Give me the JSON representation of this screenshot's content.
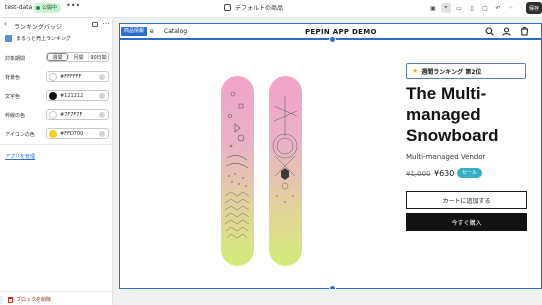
{
  "topbar": {
    "store_name": "test-data",
    "status_badge": "公開中",
    "more_label": "•••",
    "page_label": "デフォルトの商品",
    "save_label": "保存"
  },
  "panel": {
    "back_symbol": "‹",
    "title": "ランキングバッジ",
    "app_name": "まるっと売上ランキング",
    "period": {
      "label": "対象期間",
      "options": [
        "週間",
        "月間",
        "90日間"
      ],
      "selected": "週間"
    },
    "colors": [
      {
        "label": "背景色",
        "hex": "#FFFFFF",
        "swatch": "#FFFFFF"
      },
      {
        "label": "文字色",
        "hex": "#121212",
        "swatch": "#121212"
      },
      {
        "label": "枠線の色",
        "hex": "#7F7F7F",
        "swatch": "#FFFFFF"
      },
      {
        "label": "アイコンの色",
        "hex": "#FFD700",
        "swatch": "#F2D31B"
      }
    ],
    "manage_link": "アプリを管理",
    "remove_block": "ブロックを削除"
  },
  "preview": {
    "section_tag": "商品情報",
    "nav_home": "e",
    "nav_catalog": "Catalog",
    "brand": "PEPIN APP DEMO",
    "product": {
      "badge_text": "週間ランキング 第2位",
      "title": "The Multi-managed Snowboard",
      "vendor": "Multi-managed Vendor",
      "compare_price": "¥1,000",
      "price": "¥630",
      "sale_label": "セール",
      "add_to_cart": "カートに追加する",
      "buy_now": "今すぐ購入"
    }
  },
  "colors": {
    "accent": "#2C6ECB",
    "sale": "#35B0C3",
    "badge_border": "#5A7FB6",
    "star": "#F2B705"
  }
}
